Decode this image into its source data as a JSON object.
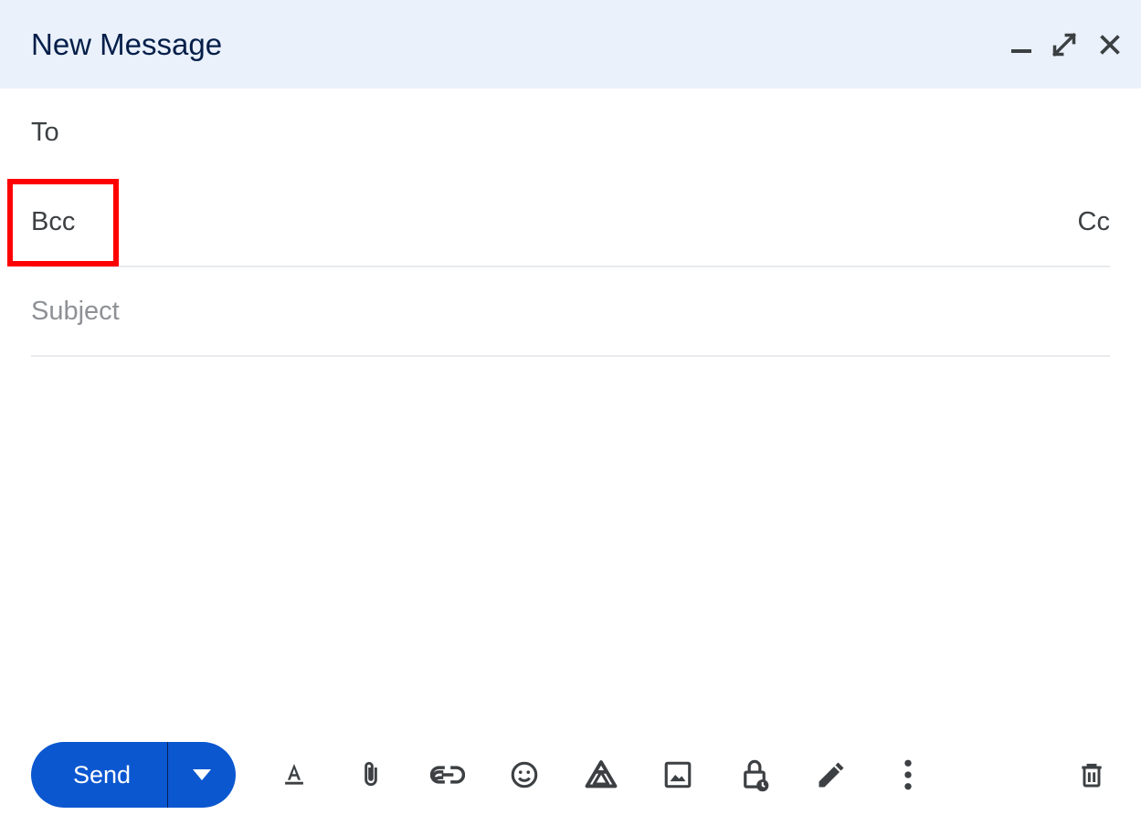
{
  "header": {
    "title": "New Message",
    "icons": {
      "minimize": "minimize",
      "fullscreen": "fullscreen",
      "close": "close"
    }
  },
  "fields": {
    "to_label": "To",
    "bcc_label": "Bcc",
    "cc_link": "Cc",
    "subject_placeholder": "Subject",
    "subject_value": ""
  },
  "toolbar": {
    "send_label": "Send",
    "icons": {
      "format": "format-text",
      "attach": "attach-file",
      "link": "insert-link",
      "emoji": "insert-emoji",
      "drive": "insert-drive",
      "photo": "insert-photo",
      "confidential": "confidential-mode",
      "signature": "insert-signature",
      "more": "more-options",
      "discard": "discard-draft"
    }
  },
  "annotations": {
    "bcc_highlight": true
  }
}
